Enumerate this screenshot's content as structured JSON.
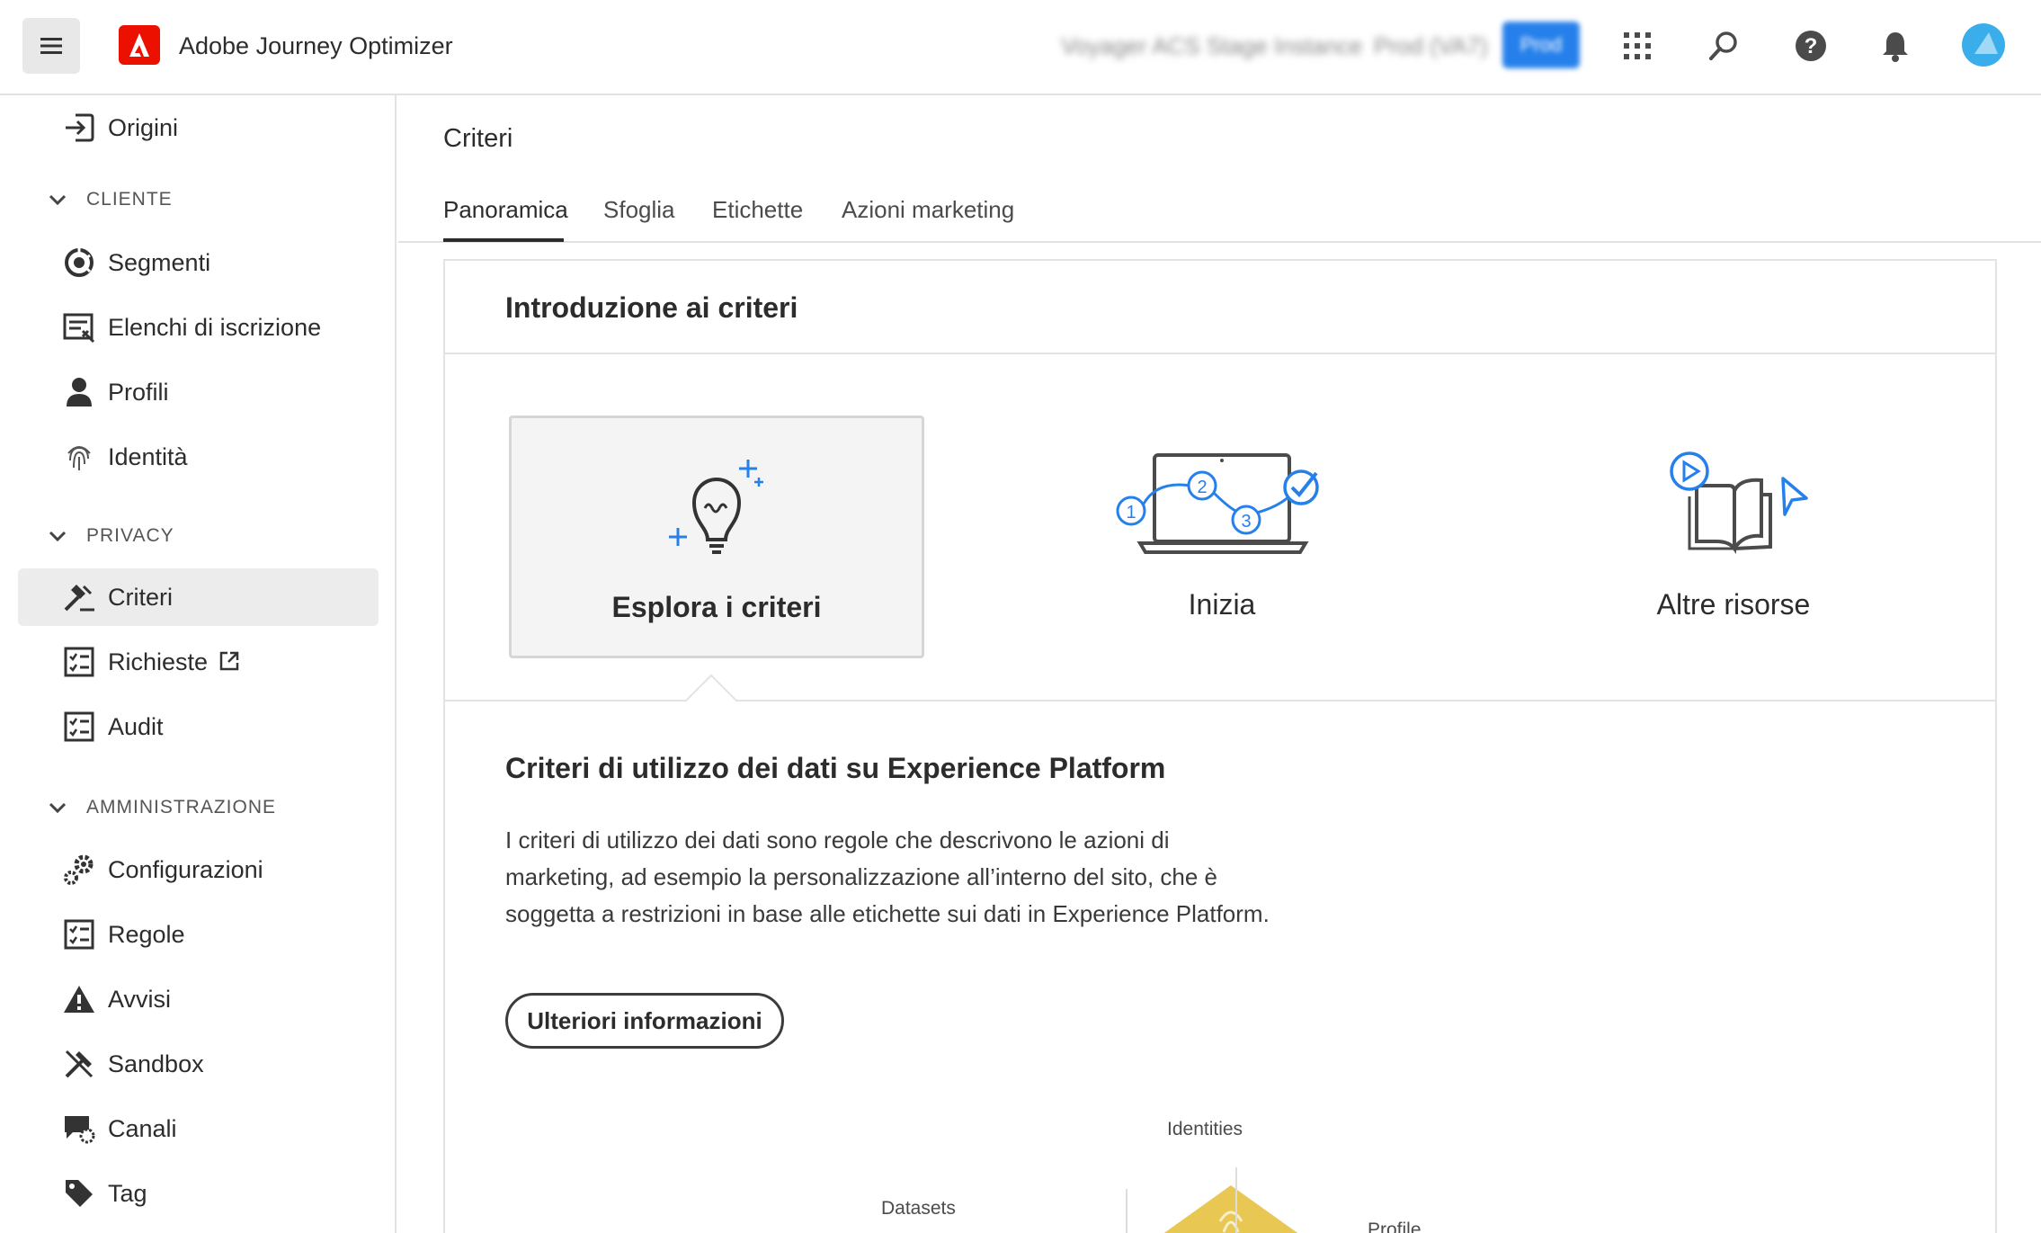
{
  "header": {
    "app_title": "Adobe Journey Optimizer",
    "org_name": "Voyager ACS Stage Instance",
    "sandbox_name": "Prod (VA7)",
    "env_badge": "Prod",
    "icons": [
      "menu-icon",
      "adobe-logo",
      "app-switcher-icon",
      "search-icon",
      "help-icon",
      "notifications-icon",
      "avatar"
    ]
  },
  "sidebar": {
    "top_item": {
      "label": "Origini",
      "icon": "sources-icon"
    },
    "sections": [
      {
        "label": "CLIENTE",
        "items": [
          {
            "label": "Segmenti",
            "icon": "segments-icon"
          },
          {
            "label": "Elenchi di iscrizione",
            "icon": "subscription-lists-icon"
          },
          {
            "label": "Profili",
            "icon": "profile-icon"
          },
          {
            "label": "Identità",
            "icon": "fingerprint-icon"
          }
        ]
      },
      {
        "label": "PRIVACY",
        "items": [
          {
            "label": "Criteri",
            "icon": "policies-icon",
            "active": true
          },
          {
            "label": "Richieste",
            "icon": "checklist-icon",
            "external": true
          },
          {
            "label": "Audit",
            "icon": "checklist-icon"
          }
        ]
      },
      {
        "label": "AMMINISTRAZIONE",
        "items": [
          {
            "label": "Configurazioni",
            "icon": "gears-icon"
          },
          {
            "label": "Regole",
            "icon": "checklist-icon"
          },
          {
            "label": "Avvisi",
            "icon": "alert-icon"
          },
          {
            "label": "Sandbox",
            "icon": "sandbox-icon"
          },
          {
            "label": "Canali",
            "icon": "channels-icon"
          },
          {
            "label": "Tag",
            "icon": "tag-icon"
          }
        ]
      }
    ]
  },
  "main": {
    "page_title": "Criteri",
    "tabs": [
      {
        "label": "Panoramica",
        "active": true
      },
      {
        "label": "Sfoglia"
      },
      {
        "label": "Etichette"
      },
      {
        "label": "Azioni marketing"
      }
    ],
    "card": {
      "title": "Introduzione ai criteri",
      "tiles": [
        {
          "label": "Esplora i criteri",
          "selected": true,
          "icon": "lightbulb-icon"
        },
        {
          "label": "Inizia",
          "icon": "laptop-steps-icon"
        },
        {
          "label": "Altre risorse",
          "icon": "book-icon"
        }
      ],
      "section_title": "Criteri di utilizzo dei dati su Experience Platform",
      "section_body": "I criteri di utilizzo dei dati sono regole che descrivono le azioni di marketing, ad esempio la personalizzazione all’interno del sito, che è soggetta a restrizioni in base alle etichette sui dati in Experience Platform.",
      "learn_more": "Ulteriori informazioni",
      "diagram_labels": {
        "identities": "Identities",
        "datasets": "Datasets",
        "profile": "Profile"
      }
    }
  },
  "colors": {
    "accent_blue": "#2680eb",
    "brand_red": "#eb1000",
    "diagram_yellow": "#e8c752"
  }
}
